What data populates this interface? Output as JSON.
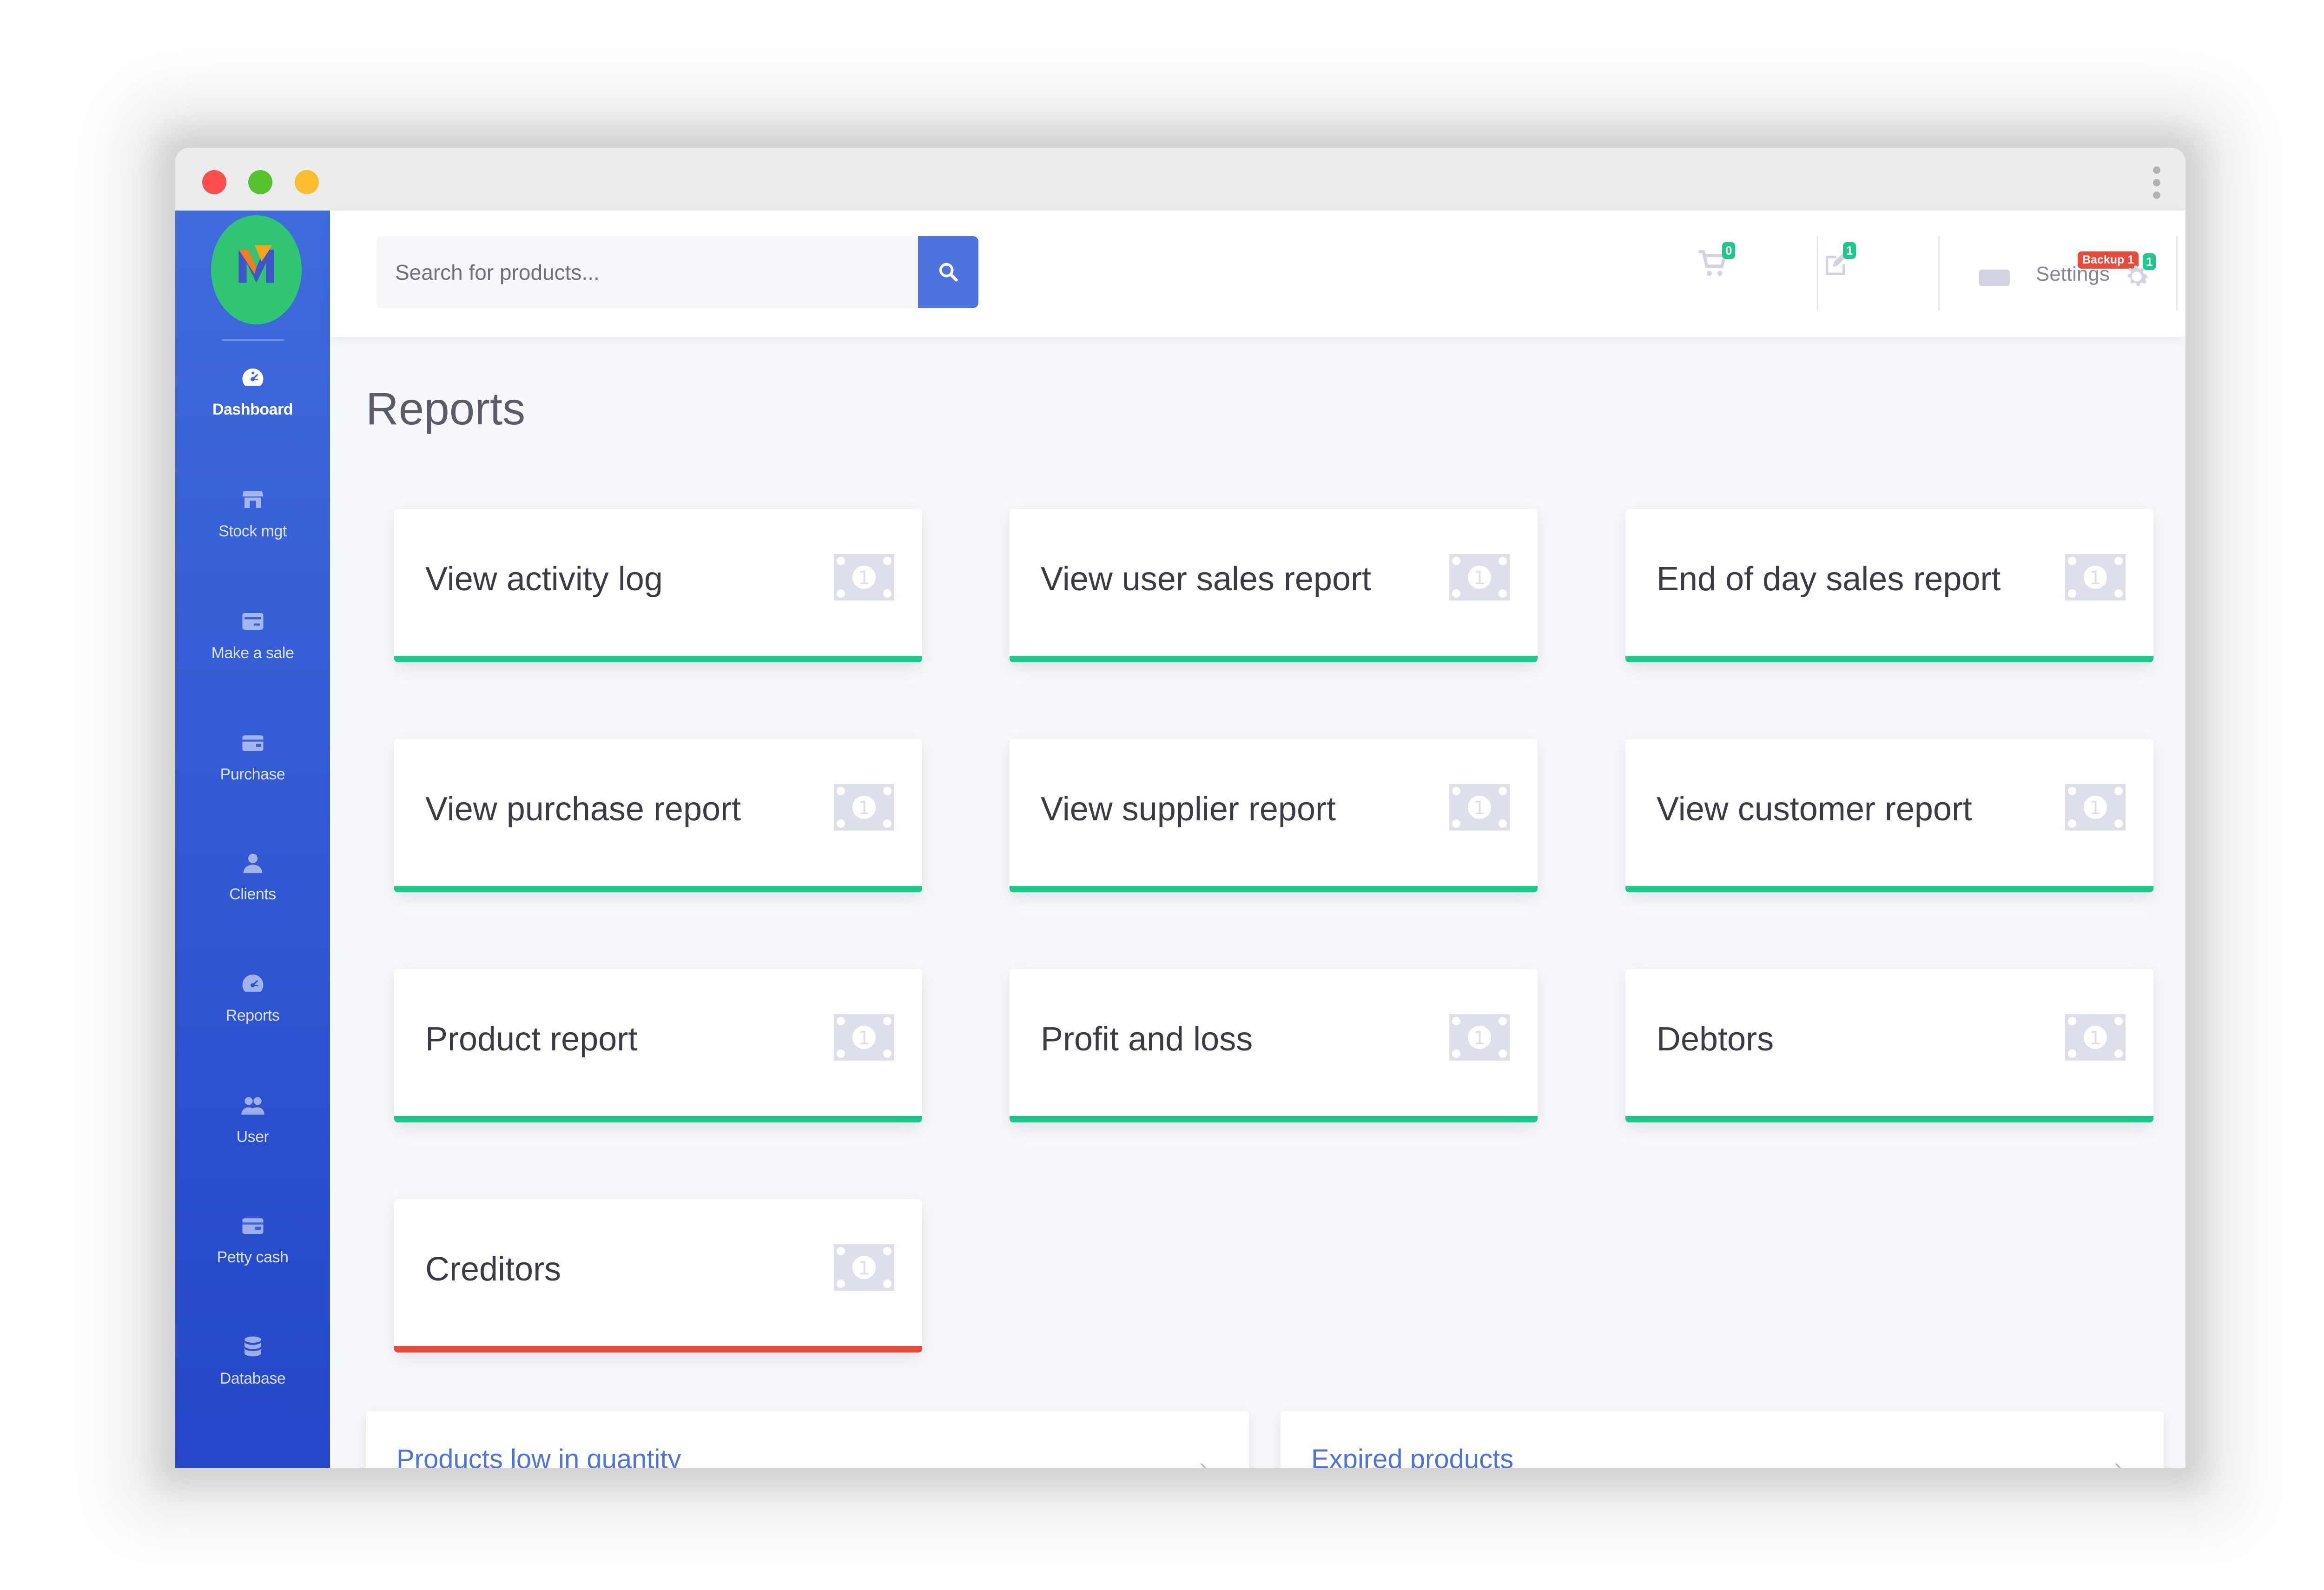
{
  "window": {
    "controls": [
      "close",
      "minimize",
      "maximize"
    ]
  },
  "sidebar": {
    "logo_icon": "app-logo",
    "items": [
      {
        "label": "Dashboard",
        "icon": "dashboard-icon",
        "active": true
      },
      {
        "label": "Stock mgt",
        "icon": "store-icon",
        "active": false
      },
      {
        "label": "Make a sale",
        "icon": "cash-register-icon",
        "active": false
      },
      {
        "label": "Purchase",
        "icon": "wallet-icon",
        "active": false
      },
      {
        "label": "Clients",
        "icon": "user-icon",
        "active": false
      },
      {
        "label": "Reports",
        "icon": "gauge-icon",
        "active": false
      },
      {
        "label": "User",
        "icon": "users-icon",
        "active": false
      },
      {
        "label": "Petty cash",
        "icon": "cash-icon",
        "active": false
      },
      {
        "label": "Database",
        "icon": "database-icon",
        "active": false
      }
    ]
  },
  "topbar": {
    "search": {
      "placeholder": "Search for products..."
    },
    "cart_count": "0",
    "edit_count": "1",
    "backup_label": "Backup 1",
    "settings_label": "Settings",
    "settings_count": "1",
    "accent_color": "#4e73df",
    "badge_color": "#1cc88a",
    "alert_color": "#e74a3b"
  },
  "main": {
    "title": "Reports",
    "cards": [
      {
        "title": "View activity log",
        "icon": "money-bill-icon",
        "bar": "green"
      },
      {
        "title": "View user sales report",
        "icon": "money-bill-icon",
        "bar": "green"
      },
      {
        "title": "End of day sales report",
        "icon": "money-bill-icon",
        "bar": "green"
      },
      {
        "title": "View purchase report",
        "icon": "money-bill-icon",
        "bar": "green"
      },
      {
        "title": "View supplier report",
        "icon": "money-bill-icon",
        "bar": "green"
      },
      {
        "title": "View customer report",
        "icon": "money-bill-icon",
        "bar": "green"
      },
      {
        "title": "Product report",
        "icon": "money-bill-icon",
        "bar": "green"
      },
      {
        "title": "Profit and loss",
        "icon": "money-bill-icon",
        "bar": "green"
      },
      {
        "title": "Debtors",
        "icon": "money-bill-icon",
        "bar": "green"
      },
      {
        "title": "Creditors",
        "icon": "money-bill-icon",
        "bar": "red"
      }
    ],
    "bottom_links": [
      {
        "label": "Products low in quantity"
      },
      {
        "label": "Expired products"
      }
    ]
  }
}
